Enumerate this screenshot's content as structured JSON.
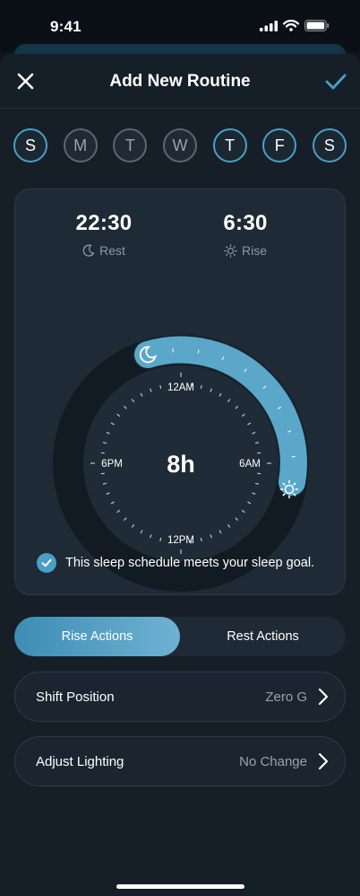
{
  "status_bar": {
    "time": "9:41"
  },
  "nav": {
    "title": "Add New Routine",
    "close_icon": "close-icon",
    "confirm_icon": "checkmark-icon"
  },
  "days": [
    {
      "label": "S",
      "selected": true
    },
    {
      "label": "M",
      "selected": false
    },
    {
      "label": "T",
      "selected": false
    },
    {
      "label": "W",
      "selected": false
    },
    {
      "label": "T",
      "selected": true
    },
    {
      "label": "F",
      "selected": true
    },
    {
      "label": "S",
      "selected": true
    }
  ],
  "schedule": {
    "rest_time": "22:30",
    "rest_label": "Rest",
    "rise_time": "6:30",
    "rise_label": "Rise",
    "duration": "8h",
    "dial_labels": {
      "top": "12AM",
      "right": "6AM",
      "bottom": "12PM",
      "left": "6PM"
    },
    "goal_message": "This sleep schedule meets your sleep goal."
  },
  "segmented": {
    "rise_label": "Rise Actions",
    "rest_label": "Rest Actions",
    "active": "rise"
  },
  "settings": [
    {
      "label": "Shift Position",
      "value": "Zero G"
    },
    {
      "label": "Adjust Lighting",
      "value": "No Change"
    }
  ],
  "colors": {
    "accent": "#4a9fc6",
    "arc": "#5aa7ca",
    "background": "#161f28",
    "card": "#1e2a35"
  }
}
